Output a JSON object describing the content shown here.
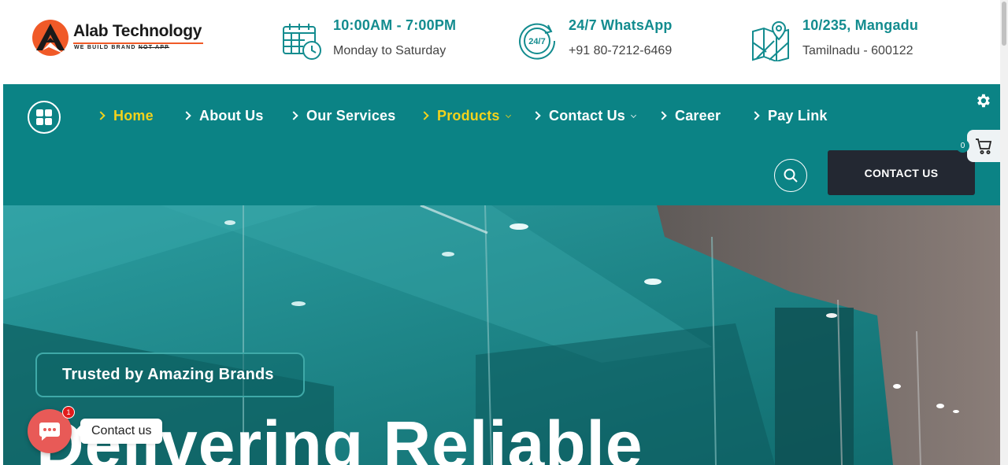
{
  "brand": {
    "name": "Alab Technology",
    "tagline_prefix": "WE BUILD BRAND",
    "tagline_struck": "NOT APP",
    "accent": "#0b8385",
    "highlight": "#f2d21c",
    "logo_orange": "#f05a28"
  },
  "topbar": {
    "hours": {
      "title": "10:00AM - 7:00PM",
      "subtitle": "Monday to Saturday",
      "icon": "calendar-clock-icon"
    },
    "whatsapp": {
      "title": "24/7 WhatsApp",
      "subtitle": "+91 80-7212-6469",
      "icon": "24-7-support-icon",
      "icon_text": "24/7"
    },
    "address": {
      "title": "10/235, Mangadu",
      "subtitle": "Tamilnadu - 600122",
      "icon": "map-pin-icon"
    }
  },
  "nav": {
    "items": [
      {
        "label": "Home",
        "active": true,
        "dropdown": false
      },
      {
        "label": "About Us",
        "active": false,
        "dropdown": false
      },
      {
        "label": "Our Services",
        "active": false,
        "dropdown": false
      },
      {
        "label": "Products",
        "active": true,
        "dropdown": true
      },
      {
        "label": "Contact Us",
        "active": false,
        "dropdown": true
      },
      {
        "label": "Career",
        "active": false,
        "dropdown": false
      },
      {
        "label": "Pay Link",
        "active": false,
        "dropdown": false
      }
    ],
    "cta_label": "CONTACT US"
  },
  "cart": {
    "count": "0"
  },
  "hero": {
    "badge": "Trusted by Amazing Brands",
    "title": "Delivering Reliable"
  },
  "chat": {
    "label": "Contact us",
    "badge_count": "1"
  }
}
